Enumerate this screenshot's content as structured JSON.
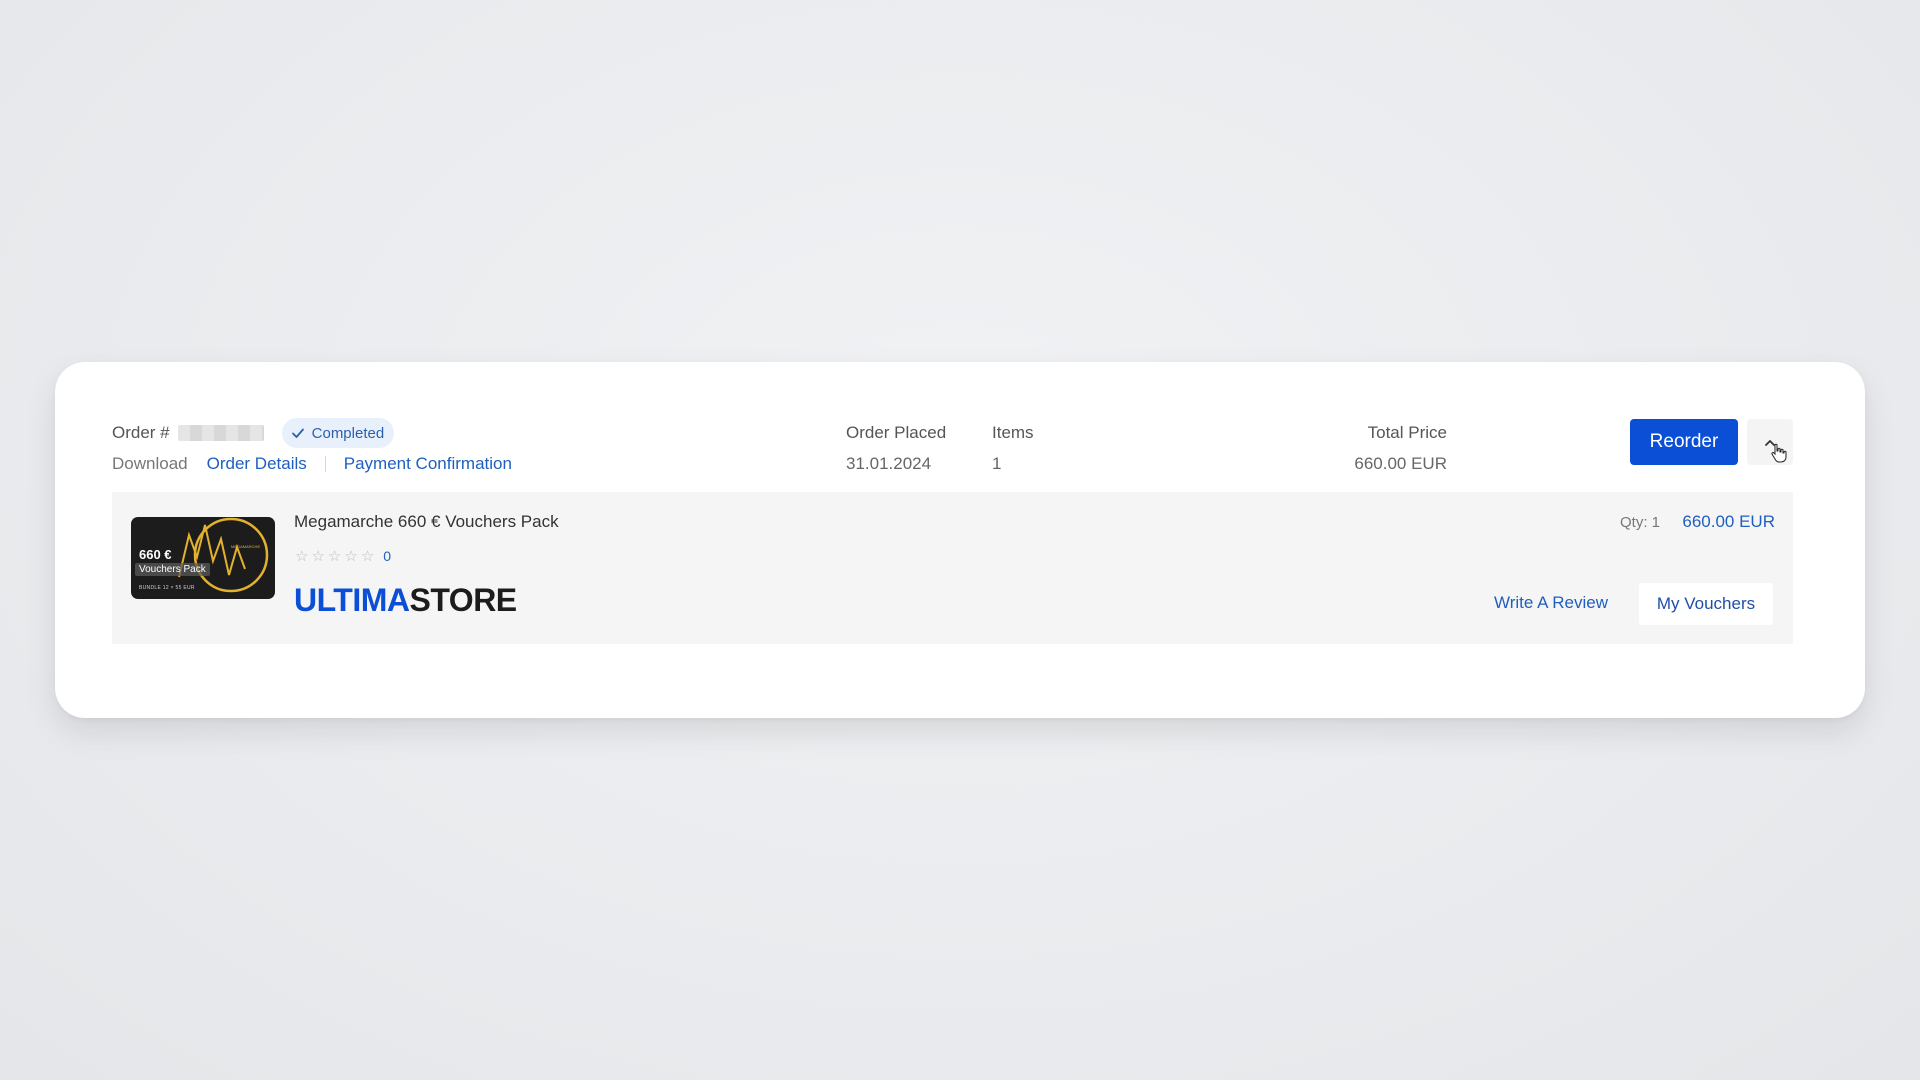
{
  "order": {
    "label": "Order #",
    "status": "Completed",
    "links": {
      "download": "Download",
      "details": "Order Details",
      "payment": "Payment Confirmation"
    },
    "placed_label": "Order Placed",
    "placed_value": "31.01.2024",
    "items_label": "Items",
    "items_value": "1",
    "total_label": "Total Price",
    "total_value": "660.00 EUR",
    "reorder_label": "Reorder",
    "toggle_icon": "chevron-up-icon"
  },
  "item": {
    "name": "Megamarche 660 € Vouchers Pack",
    "thumbnail": {
      "amount": "660 €",
      "subtitle": "Vouchers Pack",
      "bundle": "BUNDLE 12 × 55 EUR",
      "brand": "MEGAMARCHE"
    },
    "rating": {
      "stars_max": 5,
      "stars_filled": 0,
      "count": "0"
    },
    "store_logo": {
      "part1": "ULTIMA",
      "part2": "STORE"
    },
    "qty": "Qty: 1",
    "price": "660.00 EUR",
    "review_label": "Write A Review",
    "vouchers_label": "My Vouchers"
  },
  "colors": {
    "accent": "#0b4fd6",
    "link": "#1f5fbf",
    "badge_bg": "#e8f0fb",
    "row_bg": "#f5f5f5"
  }
}
